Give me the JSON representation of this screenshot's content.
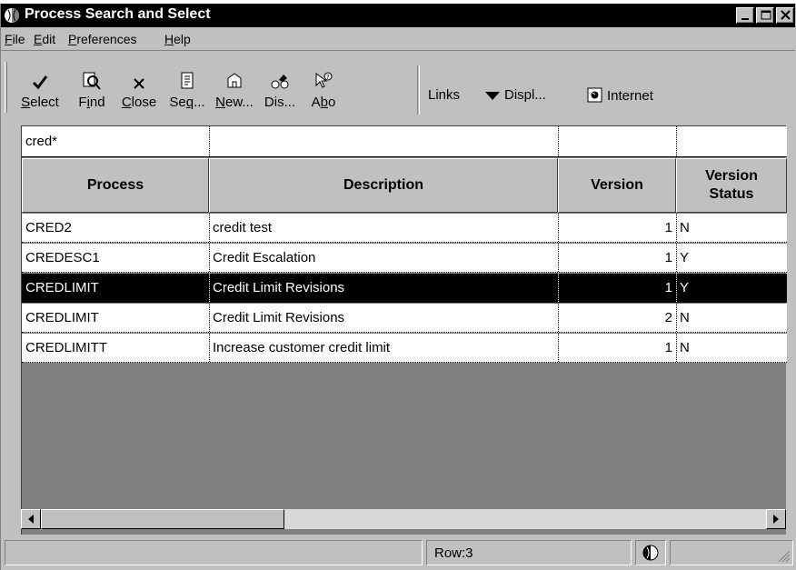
{
  "window": {
    "title": "Process Search and Select",
    "controls": [
      "minimize",
      "maximize",
      "close"
    ]
  },
  "menubar": {
    "items": [
      {
        "label": "File",
        "mnemonic": "F",
        "rest": "ile"
      },
      {
        "label": "Edit",
        "mnemonic": "E",
        "rest": "dit"
      },
      {
        "label": "Preferences",
        "mnemonic": "P",
        "rest": "references"
      },
      {
        "label": "Help",
        "mnemonic": "H",
        "rest": "elp"
      }
    ]
  },
  "toolbar": {
    "buttons": [
      {
        "icon": "checkmark-icon",
        "pre": "",
        "mn": "S",
        "post": "elect"
      },
      {
        "icon": "find-icon",
        "pre": "F",
        "mn": "i",
        "post": "nd"
      },
      {
        "icon": "close-x-icon",
        "pre": "",
        "mn": "C",
        "post": "lose"
      },
      {
        "icon": "sequence-icon",
        "pre": "Se",
        "mn": "q",
        "post": "..."
      },
      {
        "icon": "new-icon",
        "pre": "",
        "mn": "N",
        "post": "ew..."
      },
      {
        "icon": "display-icon",
        "pre": "Dis...",
        "mn": "",
        "post": ""
      },
      {
        "icon": "about-icon",
        "pre": "A",
        "mn": "b",
        "post": "o"
      }
    ],
    "links_label": "Links",
    "display_label": "Displ...",
    "internet_label": "Internet"
  },
  "grid": {
    "qbe": {
      "process": "cred*",
      "description": "",
      "version": "",
      "version_status": ""
    },
    "headers": {
      "process": "Process",
      "description": "Description",
      "version": "Version",
      "version_status_line1": "Version",
      "version_status_line2": "Status"
    },
    "rows": [
      {
        "process": "CRED2",
        "description": "credit test",
        "version": "1",
        "status": "N",
        "selected": false
      },
      {
        "process": "CREDESC1",
        "description": "Credit Escalation",
        "version": "1",
        "status": "Y",
        "selected": false
      },
      {
        "process": "CREDLIMIT",
        "description": "Credit Limit Revisions",
        "version": "1",
        "status": "Y",
        "selected": true
      },
      {
        "process": "CREDLIMIT",
        "description": "Credit Limit Revisions",
        "version": "2",
        "status": "N",
        "selected": false
      },
      {
        "process": "CREDLIMITT",
        "description": "Increase customer credit limit",
        "version": "1",
        "status": "N",
        "selected": false
      }
    ]
  },
  "statusbar": {
    "row_text": "Row:3"
  },
  "colors": {
    "selection": "#000000",
    "chrome": "#c0c0c0",
    "grid_empty": "#808080"
  }
}
